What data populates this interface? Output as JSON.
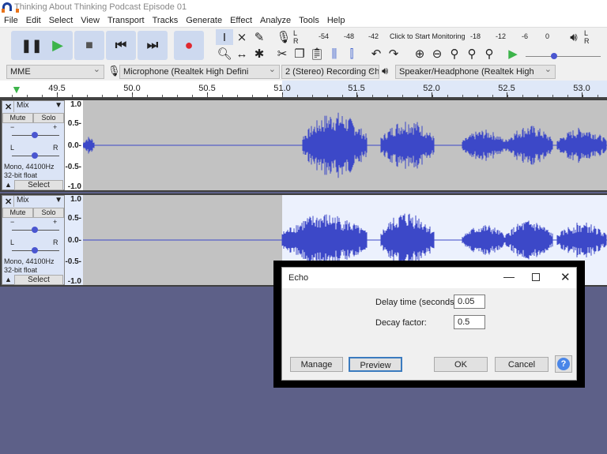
{
  "window": {
    "title": "Thinking About Thinking Podcast Episode 01"
  },
  "menu": [
    "File",
    "Edit",
    "Select",
    "View",
    "Transport",
    "Tracks",
    "Generate",
    "Effect",
    "Analyze",
    "Tools",
    "Help"
  ],
  "meter": {
    "ticks": [
      "-54",
      "-48",
      "-42",
      "-18",
      "-12",
      "-6",
      "0"
    ],
    "monitor_label": "Click to Start Monitoring",
    "lr": [
      "L",
      "R"
    ]
  },
  "devices": {
    "host": "MME",
    "input": "Microphone (Realtek High Defini",
    "channels": "2 (Stereo) Recording Chai",
    "output": "Speaker/Headphone (Realtek High"
  },
  "ruler": {
    "ticks": [
      "49.5",
      "50.0",
      "50.5",
      "51.0",
      "51.5",
      "52.0",
      "52.5",
      "53.0"
    ]
  },
  "tracks": [
    {
      "name": "Mix",
      "mute": "Mute",
      "solo": "Solo",
      "gain_min": "−",
      "gain_max": "+",
      "pan_l": "L",
      "pan_r": "R",
      "info1": "Mono, 44100Hz",
      "info2": "32-bit float",
      "select": "Select",
      "scale": [
        "1.0",
        "0.5-",
        "0.0-",
        "-0.5-",
        "-1.0"
      ]
    },
    {
      "name": "Mix",
      "mute": "Mute",
      "solo": "Solo",
      "gain_min": "−",
      "gain_max": "+",
      "pan_l": "L",
      "pan_r": "R",
      "info1": "Mono, 44100Hz",
      "info2": "32-bit float",
      "select": "Select",
      "scale": [
        "1.0",
        "0.5-",
        "0.0-",
        "-0.5-",
        "-1.0"
      ]
    }
  ],
  "dialog": {
    "title": "Echo",
    "delay_label": "Delay time (seconds):",
    "delay_value": "0.05",
    "decay_label": "Decay factor:",
    "decay_value": "0.5",
    "manage": "Manage",
    "preview": "Preview",
    "ok": "OK",
    "cancel": "Cancel",
    "help": "?"
  },
  "colors": {
    "waveform": "#3c48c8",
    "record": "#e0282f",
    "play": "#3cb44a"
  }
}
